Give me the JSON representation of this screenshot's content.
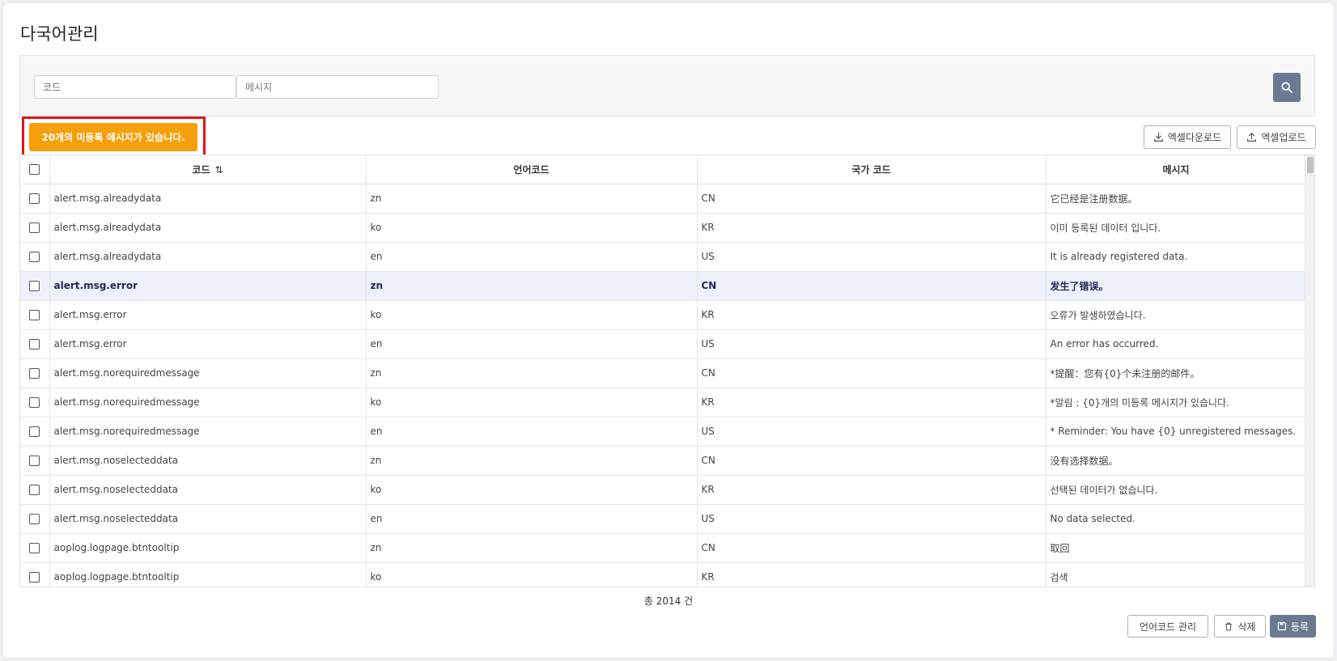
{
  "page": {
    "title": "다국어관리"
  },
  "search": {
    "code_placeholder": "코드",
    "message_placeholder": "메시지"
  },
  "alert_button": {
    "label": "20개의 미등록 메시지가 있습니다."
  },
  "toolbar": {
    "excel_download": "엑셀다운로드",
    "excel_upload": "엑셀업로드"
  },
  "table": {
    "columns": {
      "code": "코드",
      "lang_code": "언어코드",
      "country_code": "국가 코드",
      "message": "메시지"
    },
    "rows": [
      {
        "code": "alert.msg.alreadydata",
        "lang": "zn",
        "country": "CN",
        "message": "它已经是注册数据。"
      },
      {
        "code": "alert.msg.alreadydata",
        "lang": "ko",
        "country": "KR",
        "message": "이미 등록된 데이터 입니다."
      },
      {
        "code": "alert.msg.alreadydata",
        "lang": "en",
        "country": "US",
        "message": "It is already registered data."
      },
      {
        "code": "alert.msg.error",
        "lang": "zn",
        "country": "CN",
        "message": "发生了错误。"
      },
      {
        "code": "alert.msg.error",
        "lang": "ko",
        "country": "KR",
        "message": "오류가 발생하였습니다."
      },
      {
        "code": "alert.msg.error",
        "lang": "en",
        "country": "US",
        "message": "An error has occurred."
      },
      {
        "code": "alert.msg.norequiredmessage",
        "lang": "zn",
        "country": "CN",
        "message": "*提醒：您有{0}个未注册的邮件。"
      },
      {
        "code": "alert.msg.norequiredmessage",
        "lang": "ko",
        "country": "KR",
        "message": "*알림 : {0}개의 미등록 메시지가 있습니다."
      },
      {
        "code": "alert.msg.norequiredmessage",
        "lang": "en",
        "country": "US",
        "message": "* Reminder: You have {0} unregistered messages."
      },
      {
        "code": "alert.msg.noselecteddata",
        "lang": "zn",
        "country": "CN",
        "message": "没有选择数据。"
      },
      {
        "code": "alert.msg.noselecteddata",
        "lang": "ko",
        "country": "KR",
        "message": "선택된 데이터가 없습니다."
      },
      {
        "code": "alert.msg.noselecteddata",
        "lang": "en",
        "country": "US",
        "message": "No data selected."
      },
      {
        "code": "aoplog.logpage.btntooltip",
        "lang": "zn",
        "country": "CN",
        "message": "取回"
      },
      {
        "code": "aoplog.logpage.btntooltip",
        "lang": "ko",
        "country": "KR",
        "message": "검색"
      }
    ],
    "selected_row_index": 3
  },
  "footer": {
    "total": "총 2014 건",
    "lang_code_manage": "언어코드 관리",
    "delete": "삭제",
    "register": "등록"
  }
}
